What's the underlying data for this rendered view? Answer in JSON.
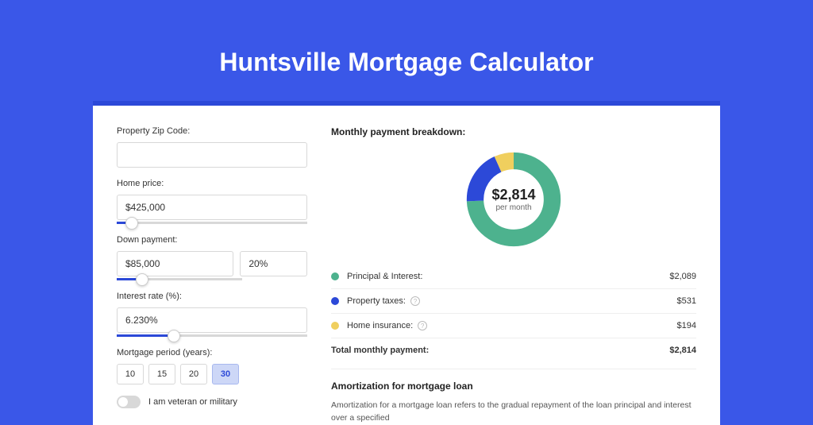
{
  "title": "Huntsville Mortgage Calculator",
  "form": {
    "zip_label": "Property Zip Code:",
    "zip_value": "",
    "home_price_label": "Home price:",
    "home_price_value": "$425,000",
    "home_price_slider_pct": 8,
    "down_payment_label": "Down payment:",
    "down_payment_value": "$85,000",
    "down_payment_pct_value": "20%",
    "down_payment_slider_pct": 20,
    "interest_label": "Interest rate (%):",
    "interest_value": "6.230%",
    "interest_slider_pct": 30,
    "period_label": "Mortgage period (years):",
    "periods": [
      "10",
      "15",
      "20",
      "30"
    ],
    "period_active": "30",
    "veteran_label": "I am veteran or military",
    "veteran_on": false
  },
  "breakdown": {
    "title": "Monthly payment breakdown:",
    "center_amount": "$2,814",
    "center_sub": "per month",
    "items": [
      {
        "label": "Principal & Interest:",
        "value": "$2,089",
        "color": "#4db28e",
        "help": false,
        "numeric": 2089
      },
      {
        "label": "Property taxes:",
        "value": "$531",
        "color": "#2c49d8",
        "help": true,
        "numeric": 531
      },
      {
        "label": "Home insurance:",
        "value": "$194",
        "color": "#f0cf5e",
        "help": true,
        "numeric": 194
      }
    ],
    "total_label": "Total monthly payment:",
    "total_value": "$2,814"
  },
  "amort": {
    "title": "Amortization for mortgage loan",
    "text": "Amortization for a mortgage loan refers to the gradual repayment of the loan principal and interest over a specified"
  },
  "chart_data": {
    "type": "pie",
    "title": "Monthly payment breakdown",
    "series": [
      {
        "name": "Principal & Interest",
        "value": 2089,
        "color": "#4db28e"
      },
      {
        "name": "Property taxes",
        "value": 531,
        "color": "#2c49d8"
      },
      {
        "name": "Home insurance",
        "value": 194,
        "color": "#f0cf5e"
      }
    ],
    "total": 2814,
    "center_label": "$2,814 per month"
  }
}
